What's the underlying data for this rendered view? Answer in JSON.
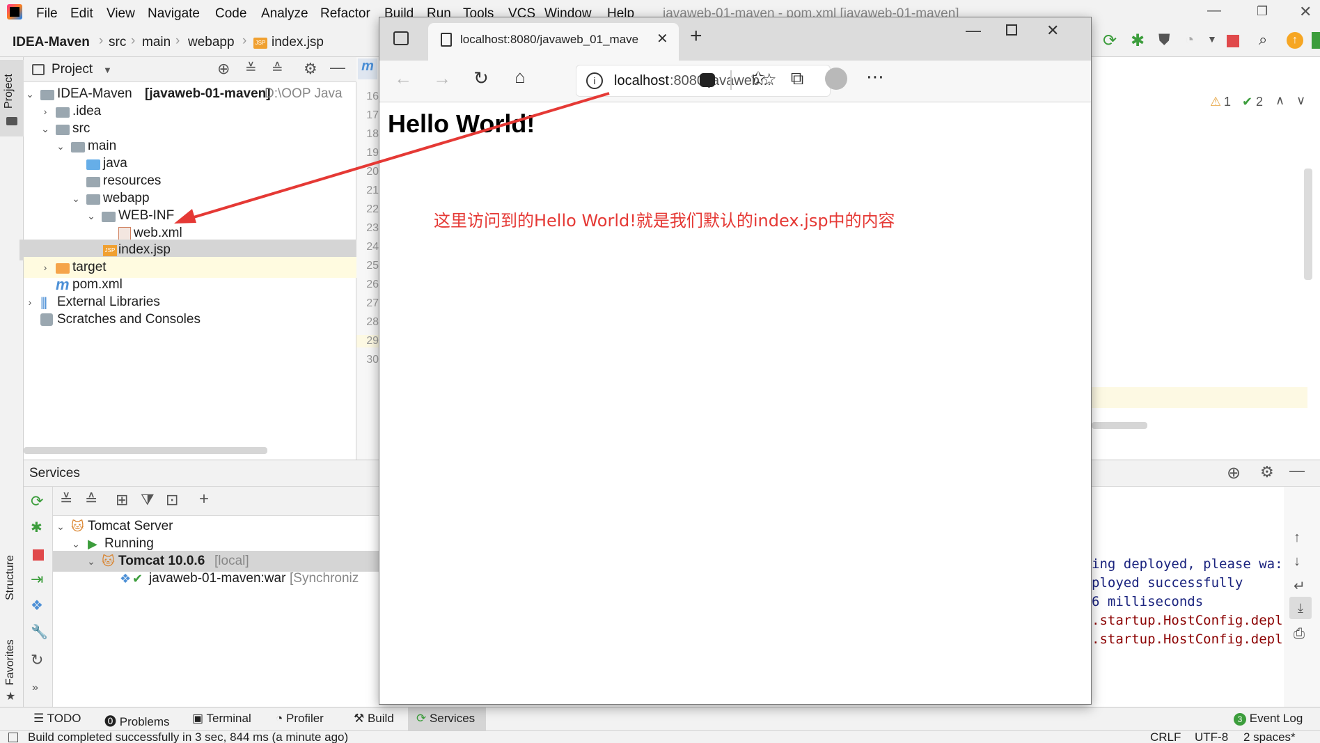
{
  "ide": {
    "menu": [
      "File",
      "Edit",
      "View",
      "Navigate",
      "Code",
      "Analyze",
      "Refactor",
      "Build",
      "Run",
      "Tools",
      "VCS",
      "Window",
      "Help"
    ],
    "title": "javaweb-01-maven - pom.xml [javaweb-01-maven]",
    "breadcrumb": [
      "IDEA-Maven",
      "src",
      "main",
      "webapp",
      "index.jsp"
    ],
    "side_labels": {
      "project": "Project",
      "structure": "Structure",
      "favorites": "Favorites"
    },
    "project": {
      "header": "Project",
      "root_name": "IDEA-Maven",
      "root_module": "[javaweb-01-maven]",
      "root_path": "D:\\OOP Java",
      "tree": [
        ".idea",
        "src",
        "main",
        "java",
        "resources",
        "webapp",
        "WEB-INF",
        "web.xml",
        "index.jsp",
        "target",
        "pom.xml",
        "External Libraries",
        "Scratches and Consoles"
      ]
    },
    "line_numbers": [
      "16",
      "17",
      "18",
      "19",
      "20",
      "21",
      "22",
      "23",
      "24",
      "25",
      "26",
      "27",
      "28",
      "29",
      "30"
    ],
    "editor_tab_glyph": "m",
    "inspections": {
      "warnings": "1",
      "ok": "2"
    },
    "services": {
      "title": "Services",
      "tree": {
        "server": "Tomcat Server",
        "status": "Running",
        "instance": "Tomcat 10.0.6",
        "instance_tag": "[local]",
        "artifact": "javaweb-01-maven:war",
        "artifact_state": "[Synchroniz"
      },
      "console_lines": [
        {
          "text": "ing deployed, please wa:",
          "color": "#1a237e"
        },
        {
          "text": "ployed successfully",
          "color": "#1a237e"
        },
        {
          "text": "6 milliseconds",
          "color": "#1a237e"
        },
        {
          "text": ".startup.HostConfig.depl",
          "color": "#8b0000"
        },
        {
          "text": ".startup.HostConfig.depl",
          "color": "#8b0000"
        }
      ]
    },
    "bottom_tabs": [
      "TODO",
      "Problems",
      "Terminal",
      "Profiler",
      "Build",
      "Services",
      "Event Log"
    ],
    "event_log_count": "3",
    "status": {
      "message": "Build completed successfully in 3 sec, 844 ms (a minute ago)",
      "line_sep": "CRLF",
      "encoding": "UTF-8",
      "indent": "2 spaces*"
    }
  },
  "browser": {
    "tab_title": "localhost:8080/javaweb_01_mave",
    "url_host": "localhost",
    "url_rest": ":8080/javaweb...",
    "heading": "Hello World!"
  },
  "annotation": {
    "text": "这里访问到的Hello World!就是我们默认的index.jsp中的内容",
    "color": "#e53935"
  }
}
